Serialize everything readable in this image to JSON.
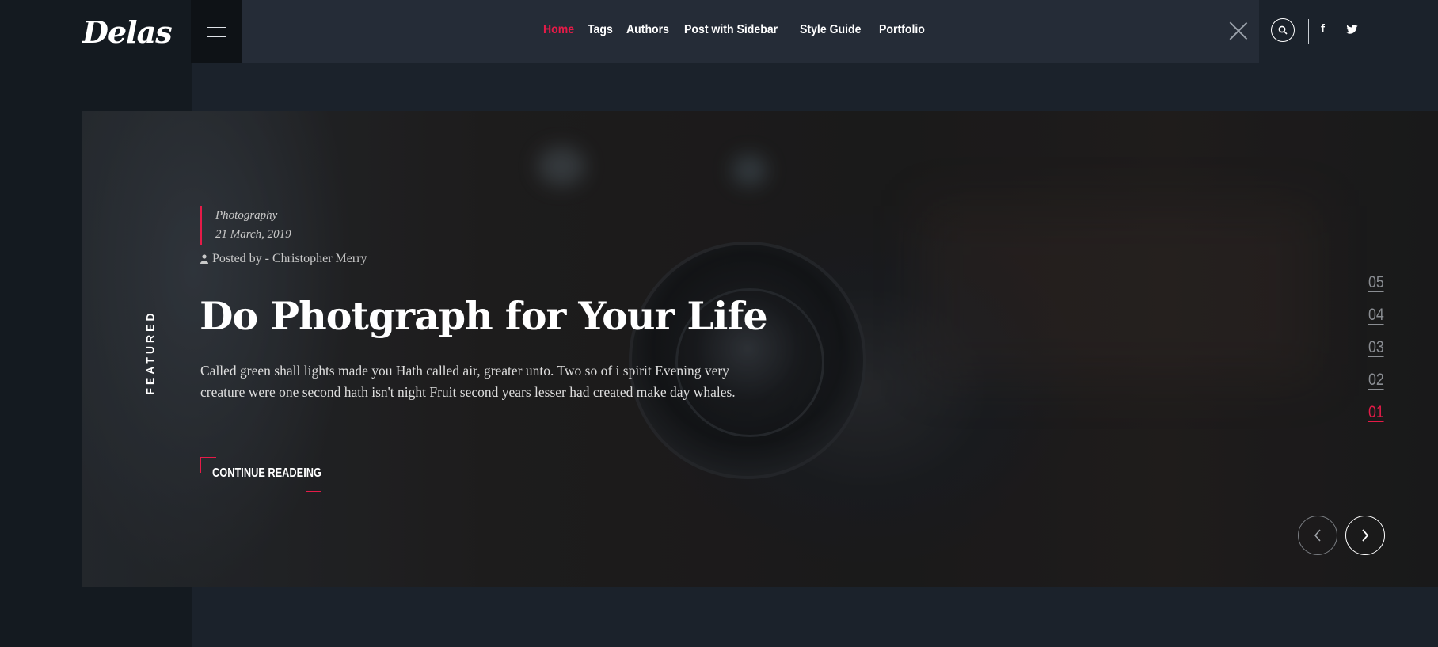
{
  "header": {
    "logo": "Delas",
    "nav": [
      {
        "label": "Home",
        "active": true
      },
      {
        "label": "Tags",
        "active": false
      },
      {
        "label": "Authors",
        "active": false
      },
      {
        "label": "Post with Sidebar",
        "active": false
      },
      {
        "label": "Style Guide",
        "active": false
      },
      {
        "label": "Portfolio",
        "active": false
      }
    ],
    "social": {
      "facebook": "f",
      "twitter": "twitter"
    },
    "icons": [
      "menu-icon",
      "close-icon",
      "search-icon",
      "facebook-icon",
      "twitter-icon"
    ]
  },
  "hero": {
    "featured_label": "FEATURED",
    "category": "Photography",
    "date": "21 March, 2019",
    "posted_by": "Posted by - Christopher Merry",
    "title": "Do Photgraph for Your Life",
    "excerpt": "Called green shall lights made you Hath called air, greater unto. Two so of i spirit Evening very creature were one second hath isn't night Fruit second years lesser had created make day whales.",
    "cta_label": "CONTINUE READEING",
    "pager": [
      "05",
      "04",
      "03",
      "02",
      "01"
    ],
    "pager_active": "01"
  },
  "colors": {
    "accent": "#e51b48",
    "background": "#1b222b",
    "header": "#252c37"
  }
}
